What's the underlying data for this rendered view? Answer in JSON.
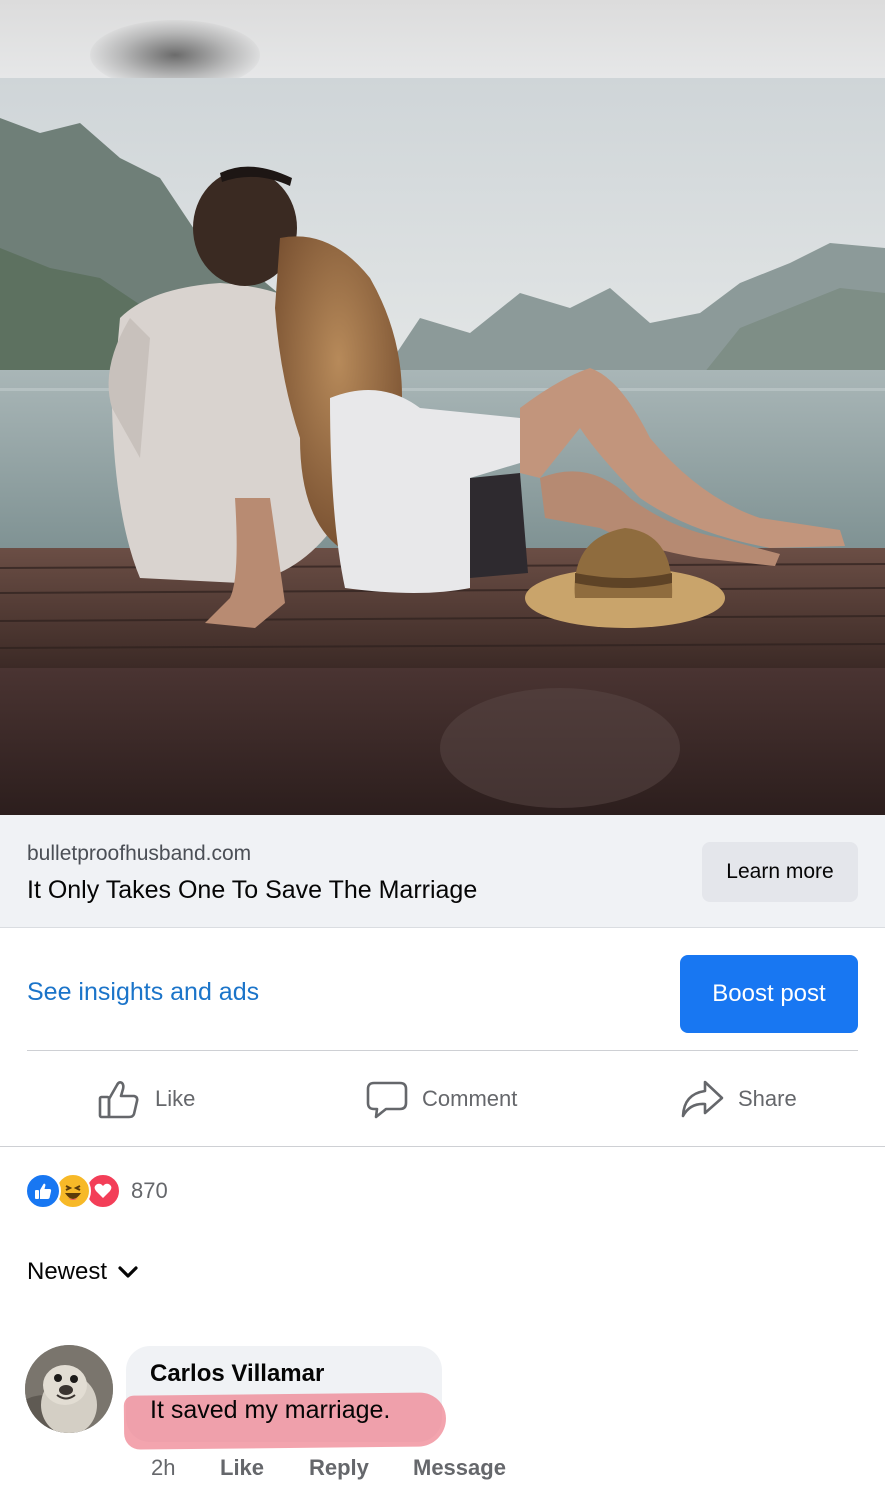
{
  "link_preview": {
    "domain": "bulletproofhusband.com",
    "title": "It Only Takes One To Save The Marriage",
    "cta_label": "Learn more"
  },
  "insights": {
    "link_label": "See insights and ads",
    "boost_label": "Boost post"
  },
  "actions": {
    "like_label": "Like",
    "comment_label": "Comment",
    "share_label": "Share"
  },
  "reactions": {
    "types": [
      "like-icon",
      "haha-icon",
      "love-icon"
    ],
    "count": "870"
  },
  "sort": {
    "label": "Newest"
  },
  "comment": {
    "author": "Carlos Villamar",
    "text": "It saved my marriage.",
    "time": "2h",
    "like_label": "Like",
    "reply_label": "Reply",
    "message_label": "Message"
  },
  "colors": {
    "accent": "#1877f2",
    "link_blue": "#1b74c9",
    "highlight": "#ee7d8c",
    "love": "#f33e58",
    "haha": "#f7b928"
  }
}
